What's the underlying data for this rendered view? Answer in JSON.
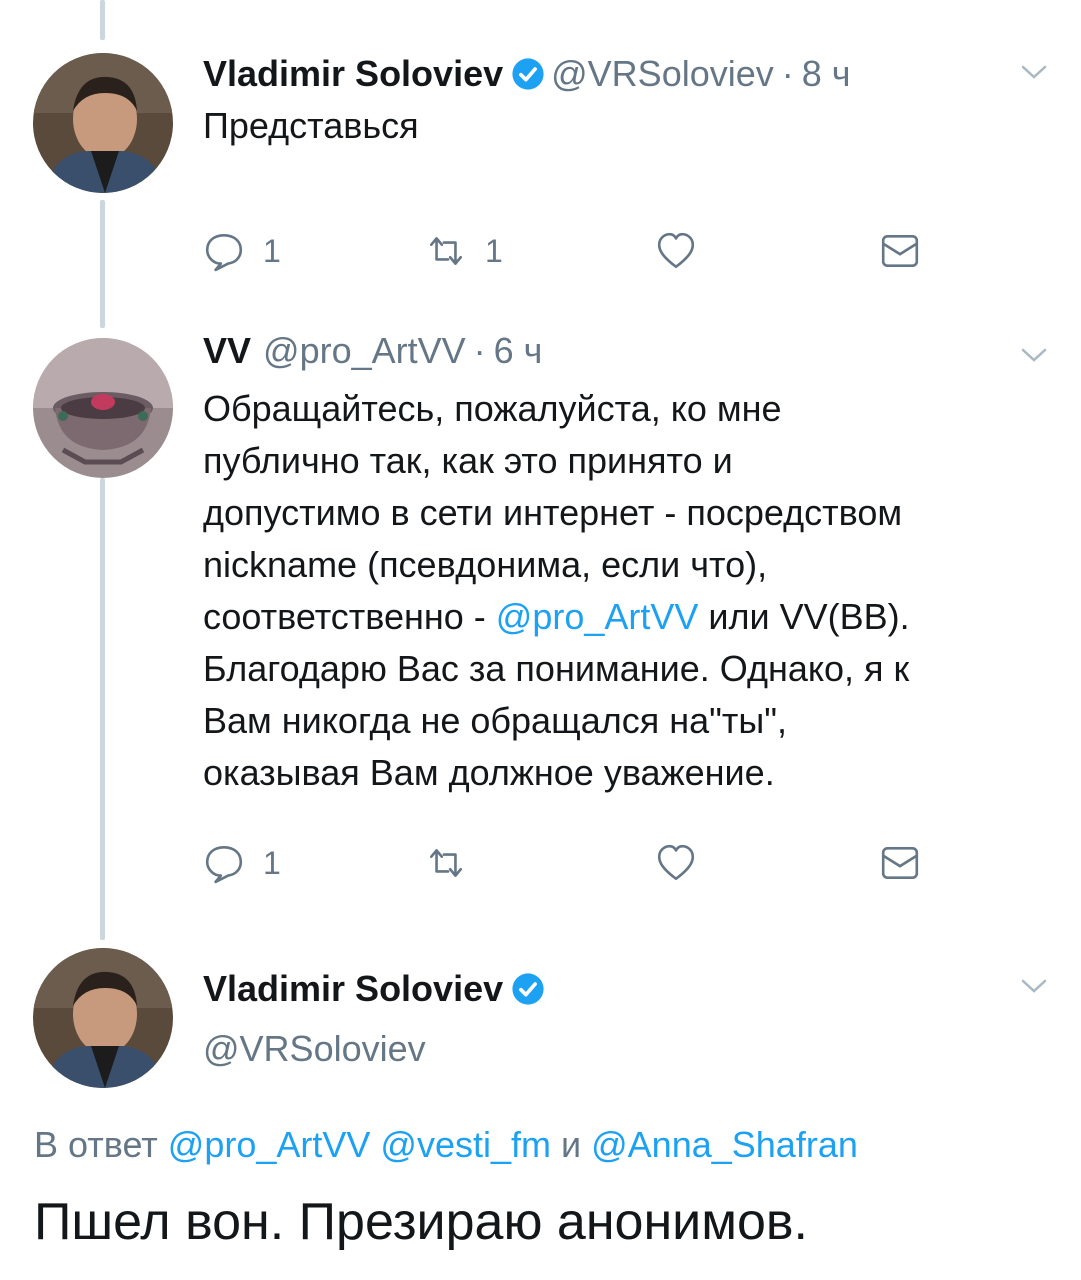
{
  "tweet1": {
    "name": "Vladimir Soloviev",
    "handle": "@VRSoloviev",
    "dot": "·",
    "time": "8 ч",
    "text": "Представься",
    "replies": "1",
    "retweets": "1"
  },
  "tweet2": {
    "name": "VV",
    "handle": "@pro_ArtVV",
    "dot": "·",
    "time": "6 ч",
    "lines": [
      "Обращайтесь, пожалуйста, ко мне",
      "публично так, как это принято и",
      "допустимо в сети интернет - посредством",
      "nickname (псевдонима, если что),"
    ],
    "line5_before": "соответственно - ",
    "line5_link": "@pro_ArtVV",
    "line5_after": " или VV(BB).",
    "lines_after": [
      "Благодарю Вас за понимание. Однако, я к",
      "Вам никогда не обращался на\"ты\",",
      "оказывая Вам должное уважение."
    ],
    "replies": "1"
  },
  "tweet3": {
    "name": "Vladimir Soloviev",
    "handle": "@VRSoloviev",
    "reply_prefix": "В ответ ",
    "reply_mentions": [
      "@pro_ArtVV",
      "@vesti_fm",
      "@Anna_Shafran"
    ],
    "reply_and": " и ",
    "text": "Пшел вон. Презираю анонимов."
  },
  "icons": {
    "verified": "verified-badge-icon",
    "reply": "reply-icon",
    "retweet": "retweet-icon",
    "like": "heart-icon",
    "dm": "envelope-icon",
    "caret": "chevron-down-icon"
  },
  "colors": {
    "link": "#1da1f2",
    "secondary": "#657786",
    "thread_line": "#ccd6dd",
    "verified": "#1da1f2"
  }
}
